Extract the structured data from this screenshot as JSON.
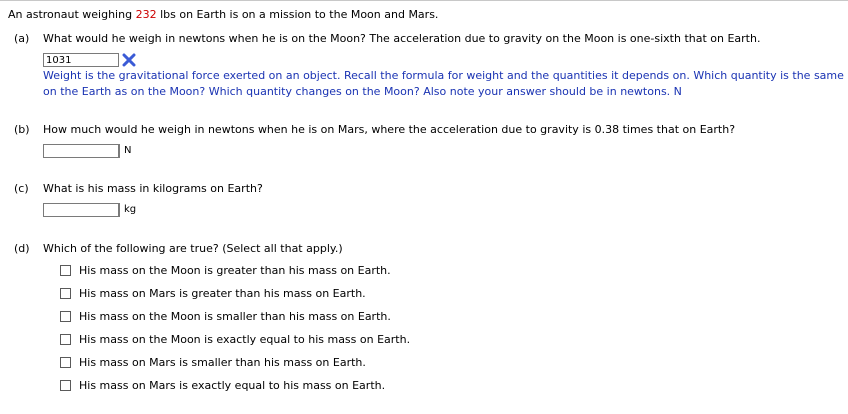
{
  "intro": {
    "before": "An astronaut weighing ",
    "value": "232",
    "after": " lbs on Earth is on a mission to the Moon and Mars."
  },
  "part_a": {
    "label": "(a)",
    "question": "What would he weigh in newtons when he is on the Moon? The acceleration due to gravity on the Moon is one-sixth that on Earth.",
    "answer_value": "1031",
    "status_icon": "incorrect-x-icon",
    "hint_line1": "Weight is the gravitational force exerted on an object. Recall the formula for weight and the quantities it depends on. Which quantity is the same",
    "hint_line2": "on the Earth as on the Moon? Which quantity changes on the Moon? Also note your answer should be in newtons. N"
  },
  "part_b": {
    "label": "(b)",
    "question": "How much would he weigh in newtons when he is on Mars, where the acceleration due to gravity is 0.38 times that on Earth?",
    "answer_value": "",
    "unit": "N"
  },
  "part_c": {
    "label": "(c)",
    "question": "What is his mass in kilograms on Earth?",
    "answer_value": "",
    "unit": "kg"
  },
  "part_d": {
    "label": "(d)",
    "question": "Which of the following are true? (Select all that apply.)",
    "options": [
      "His mass on the Moon is greater than his mass on Earth.",
      "His mass on Mars is greater than his mass on Earth.",
      "His mass on the Moon is smaller than his mass on Earth.",
      "His mass on the Moon is exactly equal to his mass on Earth.",
      "His mass on Mars is smaller than his mass on Earth.",
      "His mass on Mars is exactly equal to his mass on Earth."
    ]
  },
  "colors": {
    "highlight_value": "#cc0000",
    "hint_text": "#1a33b3",
    "x_icon": "#3b5bd6"
  }
}
